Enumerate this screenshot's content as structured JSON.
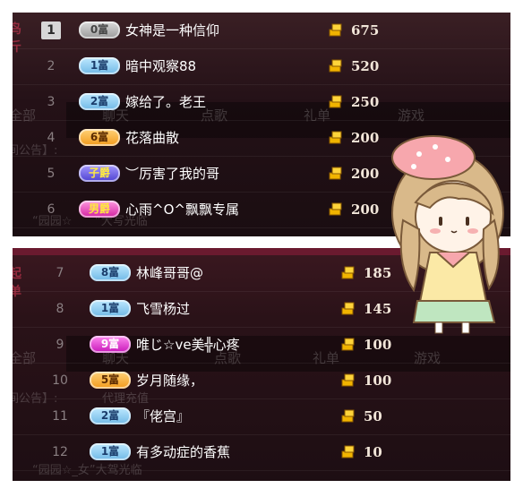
{
  "top_panel": {
    "ghost_tabs": [
      "聊天",
      "点歌",
      "礼单",
      "游戏"
    ],
    "ghost_left": [
      "全部",
      "间公告】:",
      "“园园☆",
      "”大写光临"
    ],
    "ghost_side": [
      "鸟",
      "斤"
    ],
    "rows": [
      {
        "rank": "1",
        "badge": "0富",
        "badge_style": "gray",
        "name": "女神是一种信仰",
        "score": "675"
      },
      {
        "rank": "2",
        "badge": "1富",
        "badge_style": "blue",
        "name": "暗中观察88",
        "score": "520"
      },
      {
        "rank": "3",
        "badge": "2富",
        "badge_style": "blue",
        "name": "嫁给了。老王",
        "score": "250"
      },
      {
        "rank": "4",
        "badge": "6富",
        "badge_style": "orange",
        "name": "花落曲散",
        "score": "200"
      },
      {
        "rank": "5",
        "badge": "子爵",
        "badge_style": "purple",
        "name": "︶厉害了我的哥",
        "score": "200"
      },
      {
        "rank": "6",
        "badge": "男爵",
        "badge_style": "pink",
        "name": "心雨^O^飘飘专属",
        "score": "200"
      }
    ]
  },
  "bottom_panel": {
    "ghost_tabs": [
      "聊天",
      "点歌",
      "礼单",
      "游戏"
    ],
    "ghost_left": [
      "全部",
      "间公告】:",
      "代理充值",
      "“园园☆_女”大驾光临"
    ],
    "ghost_side": [
      "起",
      "单"
    ],
    "rows": [
      {
        "rank": "7",
        "badge": "8富",
        "badge_style": "blue",
        "name": "林峰哥哥@",
        "score": "185"
      },
      {
        "rank": "8",
        "badge": "1富",
        "badge_style": "blue",
        "name": "飞雪杨过",
        "score": "145"
      },
      {
        "rank": "9",
        "badge": "9富",
        "badge_style": "magenta",
        "name": "唯じ☆ve美╬心疼",
        "score": "100"
      },
      {
        "rank": "10",
        "badge": "5富",
        "badge_style": "orange",
        "name": "岁月随缘，",
        "score": "100"
      },
      {
        "rank": "11",
        "badge": "2富",
        "badge_style": "blue",
        "name": "『佬宫』",
        "score": "50"
      },
      {
        "rank": "12",
        "badge": "1富",
        "badge_style": "blue",
        "name": "有多动症的香蕉",
        "score": "10"
      }
    ]
  },
  "icons": {
    "coin": "gold-coin-stack-icon",
    "mascot": "girl-with-beret-sticker"
  },
  "colors": {
    "panel_bg": "#1f0f14",
    "accent_red": "#6a1a2f",
    "score_text": "#f2e6d9"
  }
}
